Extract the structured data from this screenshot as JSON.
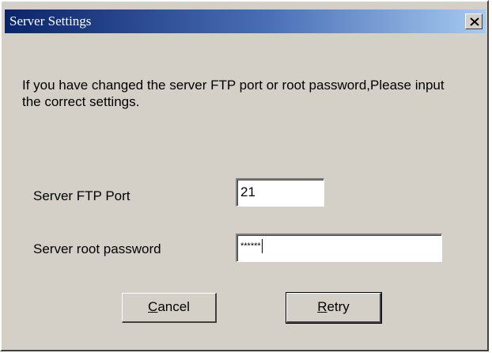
{
  "dialog": {
    "title": "Server Settings",
    "message": "If you have changed the server FTP port or root password,Please input the correct settings."
  },
  "form": {
    "ftp_port_label": "Server FTP Port",
    "ftp_port_value": "21",
    "root_password_label": "Server root password",
    "root_password_value": "******"
  },
  "buttons": {
    "cancel_label": "Cancel",
    "cancel_mnemonic": "C",
    "cancel_rest": "ancel",
    "retry_label": "Retry",
    "retry_mnemonic": "R",
    "retry_rest": "etry"
  },
  "icons": {
    "close": "close-icon"
  },
  "colors": {
    "face": "#d4d0c8",
    "title_start": "#0a246a",
    "title_end": "#a6caf0"
  }
}
